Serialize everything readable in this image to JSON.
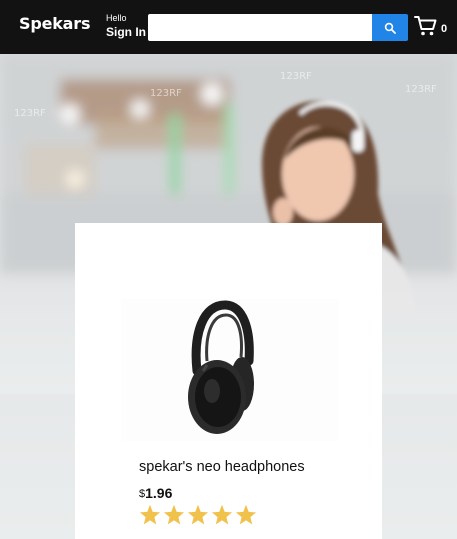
{
  "header": {
    "logo": "Spekars",
    "greeting": "Hello",
    "sign_in": "Sign In",
    "search": {
      "value": "",
      "placeholder": ""
    },
    "cart_count": "0"
  },
  "hero": {
    "image": "woman-with-headphones-banner",
    "watermark": "123RF"
  },
  "product": {
    "name": "spekar's neo headphones",
    "currency": "$",
    "price": "1.96",
    "rating": 5,
    "rating_max": 5,
    "image": "headphones-image"
  },
  "colors": {
    "header_bg": "#121212",
    "search_button": "#2185e8",
    "star": "#f0c14b",
    "page_bg": "#eaeded"
  }
}
